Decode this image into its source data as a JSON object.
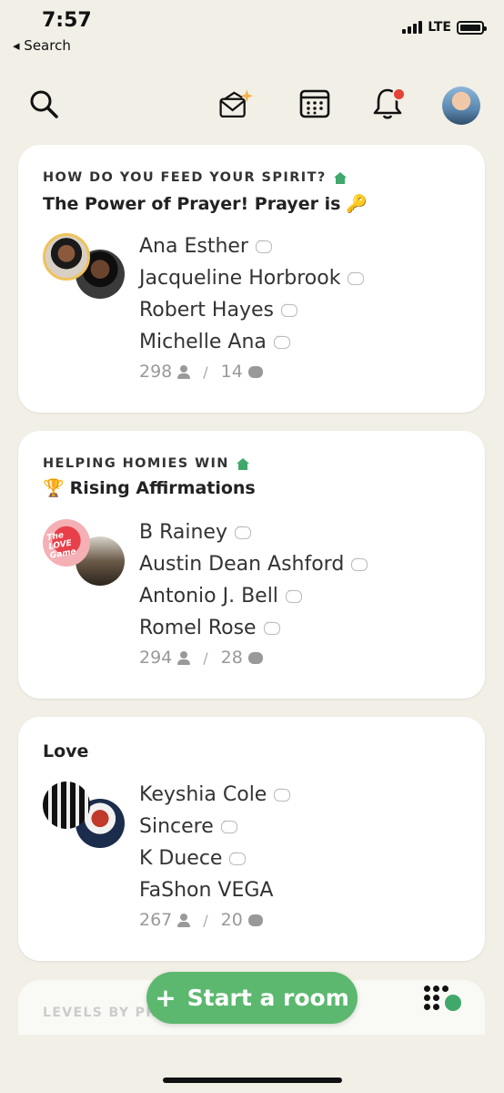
{
  "status_bar": {
    "time": "7:57",
    "back_label": "◂ Search",
    "network": "LTE"
  },
  "nav": {
    "search_icon": "search-icon",
    "invite_icon": "envelope-sparkle-icon",
    "calendar_icon": "calendar-icon",
    "bell_icon": "bell-icon",
    "notification_color": "#e44336"
  },
  "rooms": [
    {
      "club": "HOW DO YOU FEED YOUR SPIRIT?",
      "topic": "The Power of Prayer! Prayer is",
      "topic_emoji": "🔑",
      "speakers": [
        "Ana Esther",
        "Jacqueline Horbrook",
        "Robert Hayes",
        "Michelle Ana"
      ],
      "listeners": "298",
      "messages": "14"
    },
    {
      "club": "HELPING HOMIES WIN",
      "topic_emoji": "🏆",
      "topic": "Rising Affirmations",
      "speakers": [
        "B Rainey",
        "Austin Dean Ashford",
        "Antonio J. Bell",
        "Romel Rose"
      ],
      "listeners": "294",
      "messages": "28"
    },
    {
      "topic": "Love",
      "speakers": [
        "Keyshia Cole",
        "Sincere",
        "K Duece",
        "FaShon VEGA"
      ],
      "listeners": "267",
      "messages": "20"
    }
  ],
  "peek_card": {
    "club": "LEVELS BY PR"
  },
  "start_room": {
    "label": "Start a room",
    "color": "#5cb86f"
  },
  "avatar_text": "The LOVE Game"
}
